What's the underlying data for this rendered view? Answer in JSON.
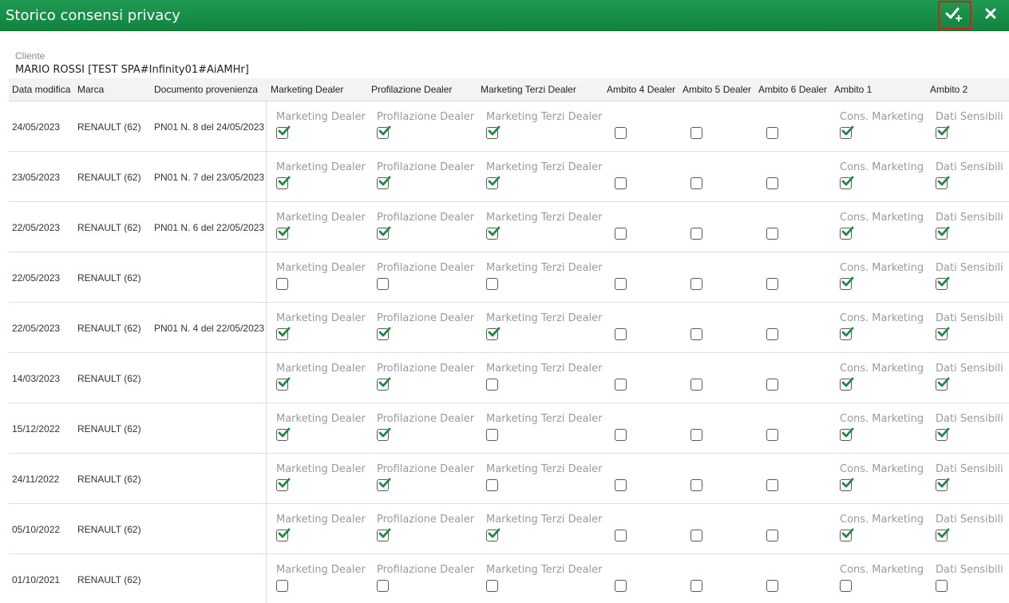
{
  "window": {
    "title": "Storico consensi privacy",
    "confirm_icon": "check-plus-icon",
    "close_icon": "close-icon",
    "colors": {
      "titlebar": "#179248",
      "check": "#1b8a3e",
      "highlight": "#d11f1f"
    }
  },
  "client": {
    "label": "Cliente",
    "value": "MARIO ROSSI  [TEST SPA#Infinity01#AiAMHr]"
  },
  "columns": [
    "Data modifica",
    "Marca",
    "Documento provenienza",
    "Marketing Dealer",
    "Profilazione Dealer",
    "Marketing Terzi Dealer",
    "Ambito 4 Dealer",
    "Ambito 5 Dealer",
    "Ambito 6 Dealer",
    "Ambito 1",
    "Ambito 2"
  ],
  "checkbox_labels": {
    "marketing_dealer": "Marketing Dealer",
    "profilazione_dealer": "Profilazione Dealer",
    "marketing_terzi_dealer": "Marketing Terzi Dealer",
    "ambito1": "Cons. Marketing",
    "ambito2": "Dati Sensibili"
  },
  "rows": [
    {
      "date": "24/05/2023",
      "brand": "RENAULT (62)",
      "document": "PN01 N. 8 del 24/05/2023",
      "checks": [
        true,
        true,
        true,
        false,
        false,
        false,
        true,
        true
      ]
    },
    {
      "date": "23/05/2023",
      "brand": "RENAULT (62)",
      "document": "PN01 N. 7 del 23/05/2023",
      "checks": [
        true,
        true,
        true,
        false,
        false,
        false,
        true,
        true
      ]
    },
    {
      "date": "22/05/2023",
      "brand": "RENAULT (62)",
      "document": "PN01 N. 6 del 22/05/2023",
      "checks": [
        true,
        true,
        true,
        false,
        false,
        false,
        true,
        true
      ]
    },
    {
      "date": "22/05/2023",
      "brand": "RENAULT (62)",
      "document": "",
      "checks": [
        false,
        false,
        false,
        false,
        false,
        false,
        true,
        true
      ]
    },
    {
      "date": "22/05/2023",
      "brand": "RENAULT (62)",
      "document": "PN01 N. 4 del 22/05/2023",
      "checks": [
        true,
        true,
        true,
        false,
        false,
        false,
        true,
        true
      ]
    },
    {
      "date": "14/03/2023",
      "brand": "RENAULT (62)",
      "document": "",
      "checks": [
        true,
        true,
        false,
        false,
        false,
        false,
        true,
        true
      ]
    },
    {
      "date": "15/12/2022",
      "brand": "RENAULT (62)",
      "document": "",
      "checks": [
        true,
        true,
        false,
        false,
        false,
        false,
        true,
        true
      ]
    },
    {
      "date": "24/11/2022",
      "brand": "RENAULT (62)",
      "document": "",
      "checks": [
        true,
        true,
        false,
        false,
        false,
        false,
        true,
        true
      ]
    },
    {
      "date": "05/10/2022",
      "brand": "RENAULT (62)",
      "document": "",
      "checks": [
        true,
        true,
        true,
        false,
        false,
        false,
        true,
        true
      ]
    },
    {
      "date": "01/10/2021",
      "brand": "RENAULT (62)",
      "document": "",
      "checks": [
        false,
        false,
        false,
        false,
        false,
        false,
        false,
        false
      ]
    }
  ]
}
